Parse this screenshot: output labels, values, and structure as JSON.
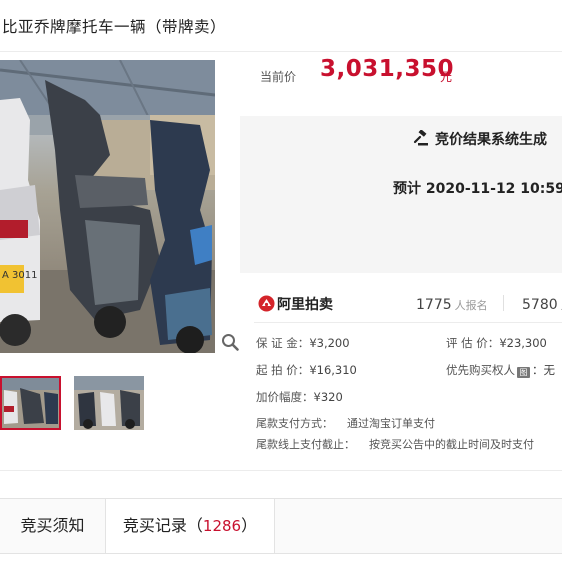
{
  "item": {
    "title": "比亚乔牌摩托车一辆（带牌卖）",
    "license_plate": "A 3011"
  },
  "price": {
    "label": "当前价",
    "value": "3,031,350",
    "unit": "元"
  },
  "status": {
    "result_text": "竞价结果系统生成",
    "expected_text": "预计 2020-11-12 10:59"
  },
  "platform": {
    "logo_text": "阿里拍卖",
    "signup_count": "1775",
    "signup_label": "人报名",
    "remind_count": "5780",
    "remind_label": "人"
  },
  "details": {
    "deposit_key": "保 证 金：",
    "deposit_value": "¥3,200",
    "appraisal_key": "评 估 价：",
    "appraisal_value": "¥23,300",
    "start_key": "起 拍 价：",
    "start_value": "¥16,310",
    "priority_key": "优先购买权人",
    "priority_icon_text": "图",
    "priority_value": "：无",
    "increment_key": "加价幅度：",
    "increment_value": "¥320",
    "pay_method_key": "尾款支付方式：",
    "pay_method_value": "通过淘宝订单支付",
    "pay_deadline_key": "尾款线上支付截止：",
    "pay_deadline_value": "按竞买公告中的截止时间及时支付"
  },
  "tabs": {
    "notice_label": "竞买须知",
    "records_label": "竞买记录",
    "records_open": "（",
    "records_count": "1286",
    "records_close": "）"
  },
  "colors": {
    "accent_red": "#c8102e",
    "status_panel_bg": "#f5f5f5"
  },
  "icons": {
    "zoom": "magnifier-icon",
    "gavel": "gavel-icon",
    "ali_logo": "ali-auction-logo-icon"
  }
}
